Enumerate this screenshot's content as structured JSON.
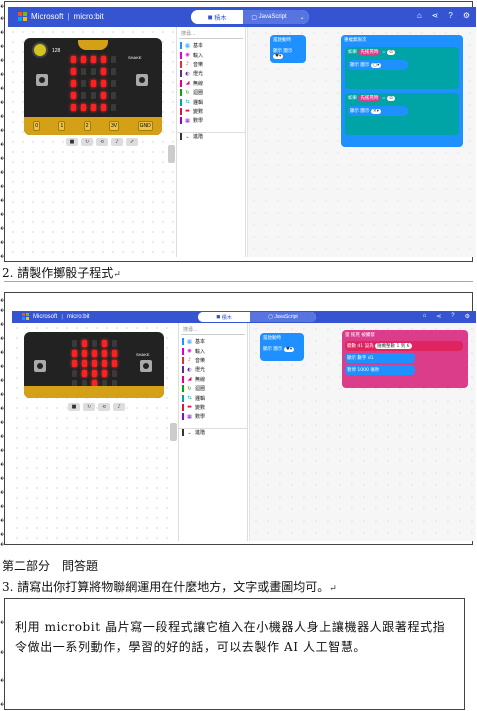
{
  "line_marker": "↵",
  "screenshots": [
    {
      "app": {
        "brand": "Microsoft",
        "product": "micro:bit",
        "tab_blocks": "積木",
        "tab_js": "JavaScript"
      },
      "sim": {
        "temp": "128",
        "shake": "SHAKE",
        "pins": [
          "0",
          "1",
          "2",
          "3V",
          "GND"
        ]
      },
      "toolbox": {
        "search": "搜尋...",
        "categories": [
          {
            "label": "基本",
            "color": "#1e90ff",
            "icon": "▦"
          },
          {
            "label": "輸入",
            "color": "#d400d4",
            "icon": "◉"
          },
          {
            "label": "音樂",
            "color": "#e63022",
            "icon": "♪"
          },
          {
            "label": "燈光",
            "color": "#5c2d91",
            "icon": "◐"
          },
          {
            "label": "無線",
            "color": "#e3008c",
            "icon": "◢"
          },
          {
            "label": "迴圈",
            "color": "#00aa00",
            "icon": "↻"
          },
          {
            "label": "邏輯",
            "color": "#00a4a6",
            "icon": "⇆"
          },
          {
            "label": "變數",
            "color": "#dc143c",
            "icon": "▬"
          },
          {
            "label": "數學",
            "color": "#9400d3",
            "icon": "▦"
          },
          {
            "label": "進階",
            "color": "#333333",
            "icon": "⌄"
          }
        ]
      },
      "blocks": {
        "start": "當啟動時",
        "show": "顯示 圖示",
        "forever": "重複無限次",
        "when": "如果",
        "shake": "先搖晃時",
        "show_icon": "顯示 圖示"
      }
    },
    {
      "app": {
        "brand": "Microsoft",
        "product": "micro:bit",
        "tab_blocks": "積木",
        "tab_js": "JavaScript"
      },
      "sim": {
        "shake": "SHAKE"
      },
      "toolbox": {
        "search": "搜尋...",
        "categories": [
          {
            "label": "基本",
            "color": "#1e90ff",
            "icon": "▦"
          },
          {
            "label": "輸入",
            "color": "#d400d4",
            "icon": "◉"
          },
          {
            "label": "音樂",
            "color": "#e63022",
            "icon": "♪"
          },
          {
            "label": "燈光",
            "color": "#5c2d91",
            "icon": "◐"
          },
          {
            "label": "無線",
            "color": "#e3008c",
            "icon": "◢"
          },
          {
            "label": "迴圈",
            "color": "#00aa00",
            "icon": "↻"
          },
          {
            "label": "邏輯",
            "color": "#00a4a6",
            "icon": "⇆"
          },
          {
            "label": "變數",
            "color": "#dc143c",
            "icon": "▬"
          },
          {
            "label": "數學",
            "color": "#9400d3",
            "icon": "▦"
          },
          {
            "label": "進階",
            "color": "#333333",
            "icon": "⌄"
          }
        ]
      },
      "blocks": {
        "start": "當啟動時",
        "show": "顯示 圖示",
        "on_shake": "當 搖晃 被觸發",
        "set_var": "變數 d1 設為",
        "random": "隨機整數 1 到 6",
        "show_num": "顯示 數字 d1",
        "pause": "暫停 1000 毫秒"
      }
    }
  ],
  "texts": {
    "line2": "2. 請製作擲骰子程式",
    "section2": "第二部分　問答題",
    "line3": "3. 請寫出你打算將物聯網運用在什麼地方，文字或畫圖均可。",
    "answer": "利用 microbit 晶片寫一段程式讓它植入在小機器人身上讓機器人跟著程式指令做出一系列動作，學習的好的話，可以去製作 AI 人工智慧。"
  }
}
